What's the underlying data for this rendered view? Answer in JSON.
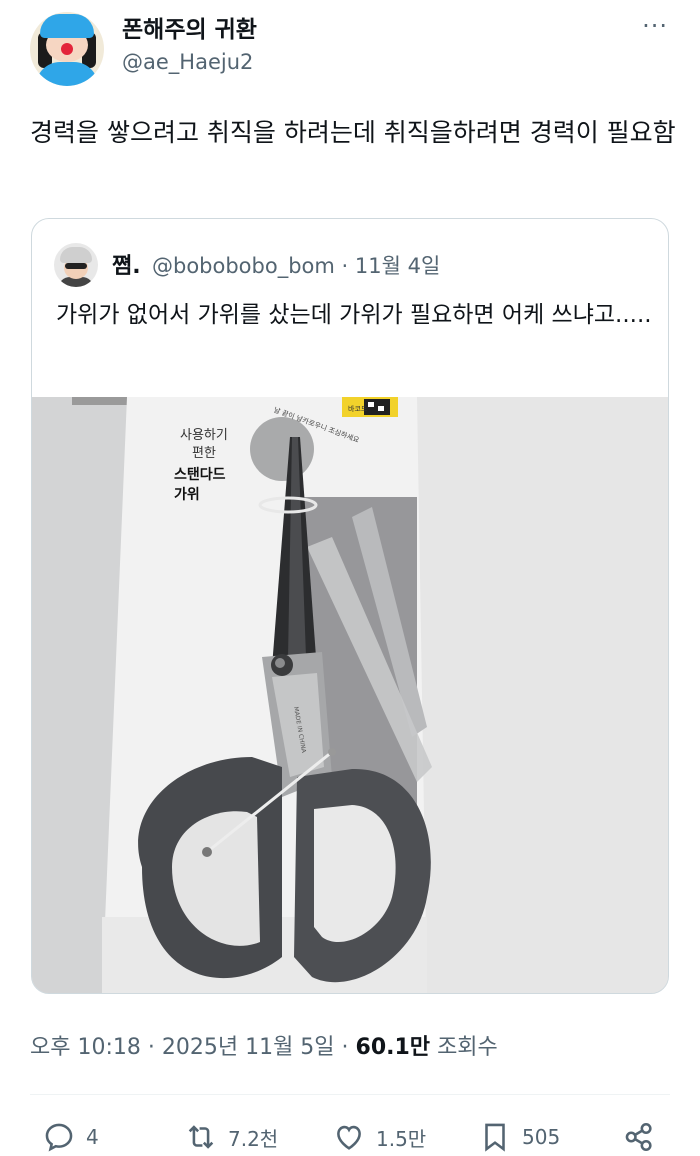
{
  "author": {
    "display_name": "폰해주의 귀환",
    "handle": "@ae_Haeju2"
  },
  "more_label": "···",
  "tweet": {
    "text": "경력을 쌓으려고 취직을 하려는데 취직을하려면 경력이 필요함"
  },
  "quote": {
    "display_name": "쪔.",
    "handle": "@bobobobo_bom",
    "date": "11월 4일",
    "text": "가위가 없어서 가위를 샀는데 가위가 필요하면 어케 쓰냐고.....",
    "image": {
      "package_text_line1": "사용하기",
      "package_text_line2": "편한",
      "package_text_line3": "스탠다드",
      "package_text_line4": "가위",
      "package_arc_text": "날 끝이 날카로우니 조심하세요",
      "package_tag_text": "바코드",
      "scissors_engraving": "MADE IN CHINA"
    }
  },
  "meta": {
    "time": "오후 10:18",
    "date": "2025년 11월 5일",
    "views_number": "60.1만",
    "views_label": "조회수",
    "separator": " · "
  },
  "actions": {
    "replies": "4",
    "retweets": "7.2천",
    "likes": "1.5만",
    "bookmarks": "505"
  },
  "colors": {
    "text_primary": "#0f1419",
    "text_secondary": "#536471",
    "border": "#cfd9de",
    "scissor_handle": "#4a4d52"
  }
}
